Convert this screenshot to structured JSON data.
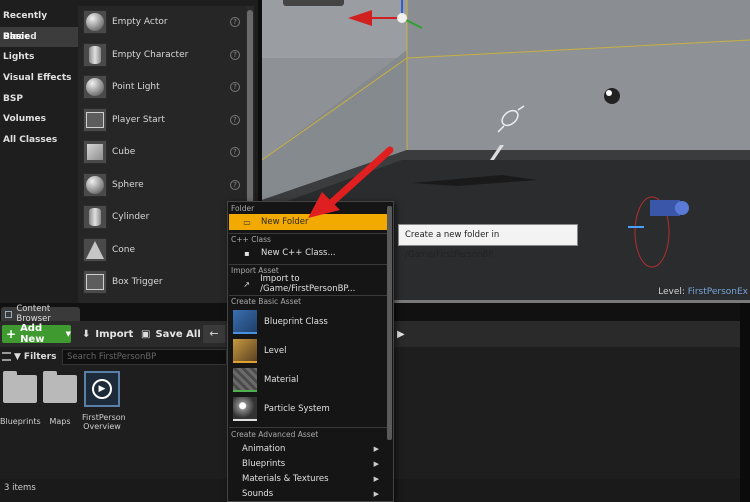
{
  "place_actors": {
    "categories": [
      "Recently Placed",
      "Basic",
      "Lights",
      "Visual Effects",
      "BSP",
      "Volumes",
      "All Classes"
    ],
    "active_category": "Basic",
    "items": [
      {
        "label": "Empty Actor",
        "icon": "sphere-icon"
      },
      {
        "label": "Empty Character",
        "icon": "mannequin-icon"
      },
      {
        "label": "Point Light",
        "icon": "light-bulb-icon"
      },
      {
        "label": "Player Start",
        "icon": "player-start-icon"
      },
      {
        "label": "Cube",
        "icon": "cube-icon"
      },
      {
        "label": "Sphere",
        "icon": "sphere-icon"
      },
      {
        "label": "Cylinder",
        "icon": "cylinder-icon"
      },
      {
        "label": "Cone",
        "icon": "cone-icon"
      },
      {
        "label": "Box Trigger",
        "icon": "box-trigger-icon"
      }
    ]
  },
  "viewport": {
    "level_label": "Level:",
    "level_name": "FirstPersonEx"
  },
  "content_browser": {
    "tab_label": "Content Browser",
    "add_new_label": "Add New",
    "import_label": "Import",
    "save_all_label": "Save All",
    "filters_label": "Filters",
    "search_placeholder": "Search FirstPersonBP",
    "assets": [
      {
        "label": "Blueprints",
        "type": "folder"
      },
      {
        "label": "Maps",
        "type": "folder"
      },
      {
        "label": "FirstPerson Overview",
        "type": "blueprint"
      }
    ],
    "status": "3 items"
  },
  "context_menu": {
    "sections": {
      "folder": "Folder",
      "cpp_class": "C++ Class",
      "import_asset": "Import Asset",
      "create_basic_asset": "Create Basic Asset",
      "create_advanced_asset": "Create Advanced Asset"
    },
    "new_folder": "New Folder",
    "new_cpp_class": "New C++ Class...",
    "import_to": "Import to /Game/FirstPersonBP...",
    "basic_assets": [
      "Blueprint Class",
      "Level",
      "Material",
      "Particle System"
    ],
    "advanced_assets": [
      "Animation",
      "Blueprints",
      "Materials & Textures",
      "Sounds"
    ],
    "tooltip": "Create a new folder in /Game/FirstPersonBP."
  },
  "colors": {
    "accent_highlight": "#f2a900",
    "add_new_green": "#3f9a2f",
    "annotation_red": "#e02020"
  }
}
